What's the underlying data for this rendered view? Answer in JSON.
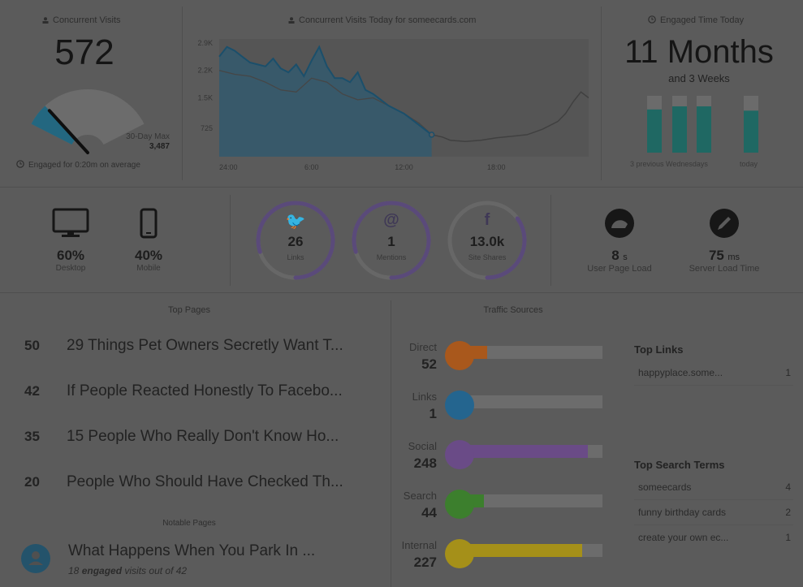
{
  "concurrent": {
    "title": "Concurrent Visits",
    "value": "572",
    "max_label": "30-Day Max",
    "max_value": "3,487",
    "engaged": "Engaged for 0:20m on average",
    "gauge_fraction": 0.164
  },
  "today_chart": {
    "title": "Concurrent Visits Today for someecards.com"
  },
  "chart_data": {
    "type": "area",
    "title": "Concurrent Visits Today for someecards.com",
    "xlabel": "",
    "ylabel": "",
    "x_ticks": [
      "24:00",
      "6:00",
      "12:00",
      "18:00"
    ],
    "y_ticks": [
      "2.9K",
      "2.2K",
      "1.5K",
      "725"
    ],
    "ylim": [
      0,
      3000
    ],
    "xlim": [
      0,
      24
    ],
    "series": [
      {
        "values": [
          [
            0,
            2550
          ],
          [
            0.5,
            2800
          ],
          [
            1,
            2700
          ],
          [
            1.5,
            2550
          ],
          [
            2,
            2400
          ],
          [
            2.5,
            2350
          ],
          [
            3,
            2300
          ],
          [
            3.5,
            2500
          ],
          [
            4,
            2250
          ],
          [
            4.5,
            2150
          ],
          [
            5,
            2350
          ],
          [
            5.5,
            2050
          ],
          [
            6,
            2450
          ],
          [
            6.5,
            2800
          ],
          [
            7,
            2300
          ],
          [
            7.5,
            2000
          ],
          [
            8,
            2000
          ],
          [
            8.5,
            1900
          ],
          [
            9,
            2150
          ],
          [
            9.5,
            1700
          ],
          [
            10,
            1600
          ],
          [
            10.5,
            1450
          ],
          [
            11,
            1300
          ],
          [
            11.5,
            1200
          ],
          [
            12,
            1100
          ],
          [
            12.5,
            950
          ],
          [
            13,
            800
          ],
          [
            13.5,
            650
          ],
          [
            13.8,
            560
          ]
        ]
      },
      {
        "values": [
          [
            0,
            2200
          ],
          [
            1,
            2100
          ],
          [
            2,
            2050
          ],
          [
            3,
            1900
          ],
          [
            4,
            1700
          ],
          [
            5,
            1650
          ],
          [
            6,
            2000
          ],
          [
            7,
            1900
          ],
          [
            8,
            1600
          ],
          [
            9,
            1450
          ],
          [
            10,
            1500
          ],
          [
            11,
            1300
          ],
          [
            12,
            1100
          ],
          [
            13,
            850
          ],
          [
            13.8,
            560
          ]
        ]
      },
      {
        "values": [
          [
            13.8,
            560
          ],
          [
            14.5,
            500
          ],
          [
            15,
            420
          ],
          [
            16,
            390
          ],
          [
            17,
            420
          ],
          [
            18,
            480
          ],
          [
            19,
            520
          ],
          [
            20,
            560
          ],
          [
            21,
            700
          ],
          [
            22,
            900
          ],
          [
            22.5,
            1100
          ],
          [
            23,
            1400
          ],
          [
            23.5,
            1650
          ],
          [
            24,
            1500
          ]
        ]
      }
    ]
  },
  "engaged_time": {
    "title": "Engaged Time Today",
    "value": "11 Months",
    "sub": "and 3 Weeks",
    "caption_prev": "3 previous Wednesdays",
    "caption_today": "today",
    "bars": [
      0.7,
      0.75,
      0.75,
      0.68
    ]
  },
  "devices": [
    {
      "pct": "60%",
      "label": "Desktop",
      "icon": "desktop-icon"
    },
    {
      "pct": "40%",
      "label": "Mobile",
      "icon": "mobile-icon"
    }
  ],
  "social": [
    {
      "value": "26",
      "label": "Links",
      "icon": "twitter-icon",
      "glyph": "🐦",
      "fraction": 0.8
    },
    {
      "value": "1",
      "label": "Mentions",
      "icon": "at-icon",
      "glyph": "@",
      "fraction": 0.8
    },
    {
      "value": "13.0k",
      "label": "Site Shares",
      "icon": "facebook-icon",
      "glyph": "f",
      "fraction": 0.35
    }
  ],
  "perf": [
    {
      "value": "8",
      "unit": "s",
      "label": "User Page Load",
      "icon": "speedometer-icon"
    },
    {
      "value": "75",
      "unit": "ms",
      "label": "Server Load Time",
      "icon": "pencil-icon"
    }
  ],
  "top_pages": {
    "title": "Top Pages",
    "rows": [
      {
        "count": "50",
        "title": "29 Things Pet Owners Secretly Want T..."
      },
      {
        "count": "42",
        "title": "If People Reacted Honestly To Facebo..."
      },
      {
        "count": "35",
        "title": "15 People Who Really Don't Know Ho..."
      },
      {
        "count": "20",
        "title": "People Who Should Have Checked Th..."
      }
    ]
  },
  "notable": {
    "title": "Notable Pages",
    "headline": "What Happens When You Park In ...",
    "detail_count": "18",
    "detail_word": "engaged",
    "detail_rest": "visits out of 42"
  },
  "traffic": {
    "title": "Traffic Sources",
    "sources": [
      {
        "label": "Direct",
        "value": "52",
        "color": "#a9581c",
        "fraction": 0.2
      },
      {
        "label": "Links",
        "value": "1",
        "color": "#24658f",
        "fraction": 0.03
      },
      {
        "label": "Social",
        "value": "248",
        "color": "#6a4b87",
        "fraction": 0.9
      },
      {
        "label": "Search",
        "value": "44",
        "color": "#3c7f2d",
        "fraction": 0.18
      },
      {
        "label": "Internal",
        "value": "227",
        "color": "#a59019",
        "fraction": 0.86
      }
    ]
  },
  "top_links": {
    "title": "Top Links",
    "rows": [
      {
        "name": "happyplace.some...",
        "count": "1"
      }
    ]
  },
  "top_search": {
    "title": "Top Search Terms",
    "rows": [
      {
        "name": "someecards",
        "count": "4"
      },
      {
        "name": "funny birthday cards",
        "count": "2"
      },
      {
        "name": "create your own ec...",
        "count": "1"
      }
    ]
  }
}
